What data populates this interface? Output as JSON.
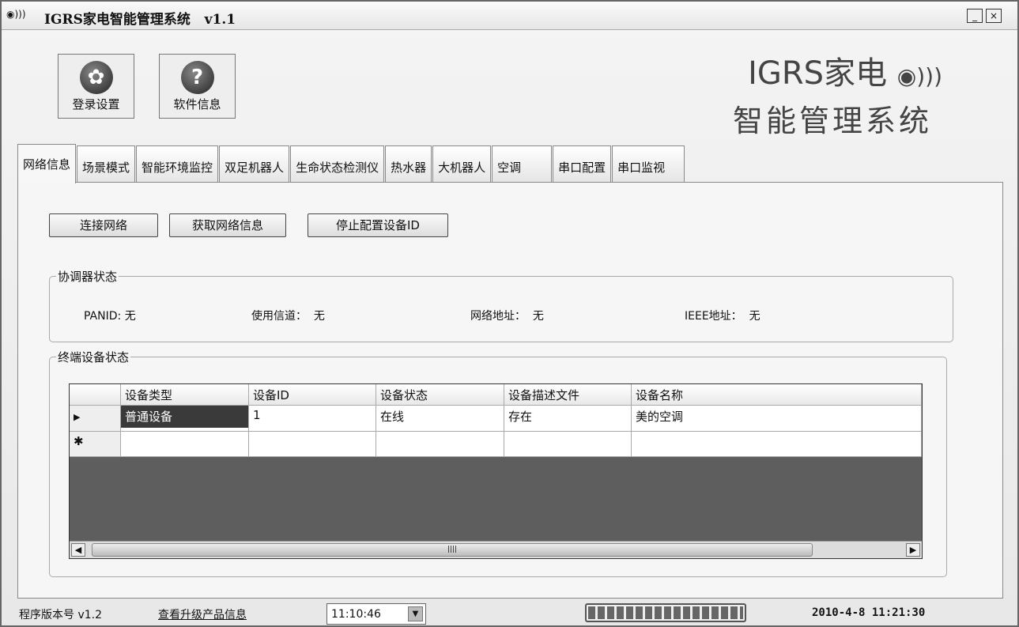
{
  "window": {
    "title": "IGRS家电智能管理系统",
    "version": "v1.1",
    "minimize": "_",
    "close": "×",
    "app_icon": "signal-icon"
  },
  "toolbar": [
    {
      "label": "登录设置",
      "icon": "gear-flower-icon"
    },
    {
      "label": "软件信息",
      "icon": "help-icon",
      "glyph": "?"
    }
  ],
  "logo": {
    "line1": "IGRS家电",
    "line2": "智能管理系统",
    "icon": "signal-icon"
  },
  "tabs": [
    "网络信息",
    "场景模式",
    "智能环境监控",
    "双足机器人",
    "生命状态检测仪",
    "热水器",
    "大机器人",
    "空调",
    "串口配置",
    "串口监视"
  ],
  "buttons": {
    "connect": "连接网络",
    "get_info": "获取网络信息",
    "stop_config": "停止配置设备ID"
  },
  "coordinator": {
    "title": "协调器状态",
    "panid_label": "PANID:",
    "panid": "无",
    "channel_label": "使用信道：",
    "channel": "无",
    "addr_label": "网络地址：",
    "addr": "无",
    "ieee_label": "IEEE地址：",
    "ieee": "无"
  },
  "devices": {
    "title": "终端设备状态",
    "columns": [
      "设备类型",
      "设备ID",
      "设备状态",
      "设备描述文件",
      "设备名称"
    ],
    "rows": [
      [
        "普通设备",
        "1",
        "在线",
        "存在",
        "美的空调"
      ]
    ],
    "current_marker": "▶",
    "new_marker": "✱",
    "scroll_grip": "||||"
  },
  "status": {
    "version": "程序版本号 v1.2",
    "upgrade_link": "查看升级产品信息",
    "time": "11:10:46",
    "datetime": "2010-4-8 11:21:30",
    "progress": 1.0
  }
}
